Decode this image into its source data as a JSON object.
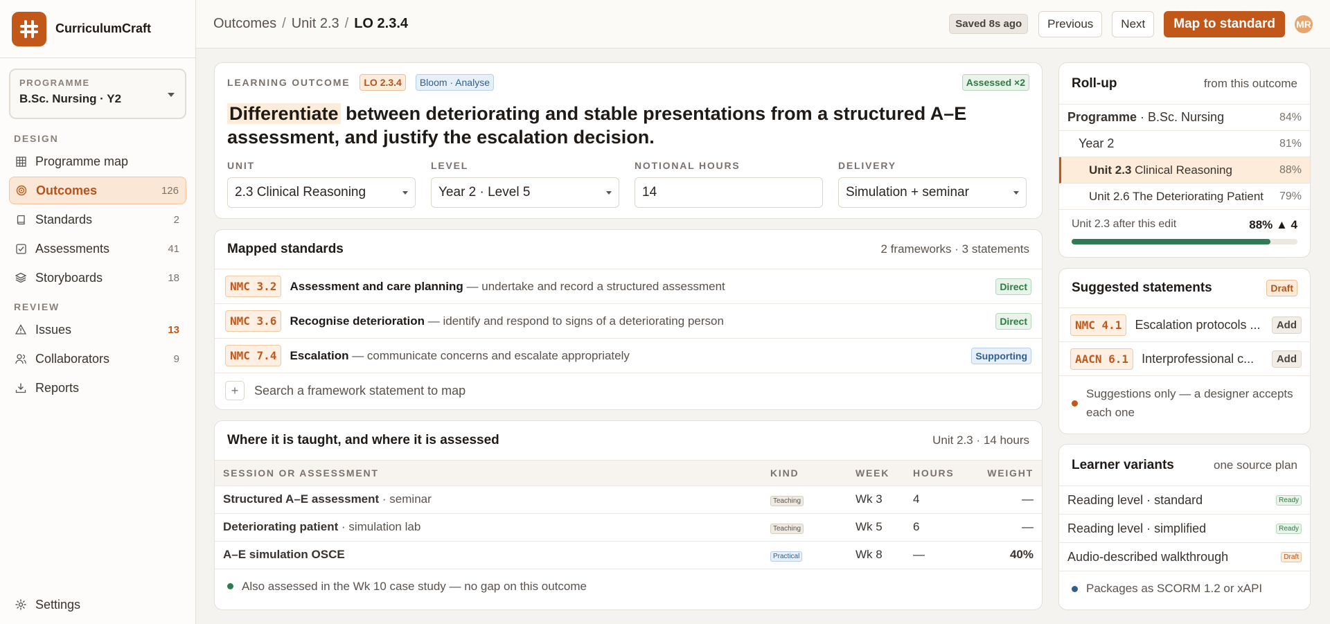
{
  "app": {
    "name": "CurriculumCraft"
  },
  "programme": {
    "label": "PROGRAMME",
    "value": "B.Sc. Nursing · Y2"
  },
  "nav": {
    "design_label": "DESIGN",
    "review_label": "REVIEW",
    "design_items": [
      {
        "label": "Programme map",
        "count": "",
        "icon": "grid-icon"
      },
      {
        "label": "Outcomes",
        "count": "126",
        "icon": "target-icon"
      },
      {
        "label": "Standards",
        "count": "2",
        "icon": "book-icon"
      },
      {
        "label": "Assessments",
        "count": "41",
        "icon": "checkbox-icon"
      },
      {
        "label": "Storyboards",
        "count": "18",
        "icon": "layers-icon"
      }
    ],
    "review_items": [
      {
        "label": "Issues",
        "count": "13",
        "icon": "warning-icon"
      },
      {
        "label": "Collaborators",
        "count": "9",
        "icon": "users-icon"
      },
      {
        "label": "Reports",
        "count": "",
        "icon": "download-icon"
      }
    ],
    "settings_label": "Settings"
  },
  "topbar": {
    "crumbs": [
      "Outcomes",
      "Unit 2.3",
      "LO 2.3.4"
    ],
    "saved": "Saved 8s ago",
    "previous": "Previous",
    "next": "Next",
    "primary": "Map to standard",
    "avatar": "MR"
  },
  "outcome": {
    "label": "LEARNING OUTCOME",
    "code": "LO 2.3.4",
    "bloom": "Bloom · Analyse",
    "assessed": "Assessed ×2",
    "verb": "Differentiate",
    "statement": " between deteriorating and stable presentations from a structured A–E assessment, and justify the escalation decision.",
    "fields": [
      {
        "label": "UNIT",
        "value": "2.3 Clinical Reasoning",
        "dropdown": true
      },
      {
        "label": "LEVEL",
        "value": "Year 2 · Level 5",
        "dropdown": true
      },
      {
        "label": "NOTIONAL HOURS",
        "value": "14",
        "dropdown": false
      },
      {
        "label": "DELIVERY",
        "value": "Simulation + seminar",
        "dropdown": true
      }
    ]
  },
  "mapped": {
    "title": "Mapped standards",
    "sub": "2 frameworks · 3 statements",
    "rows": [
      {
        "code": "NMC 3.2",
        "name": "Assessment and care planning",
        "desc": " — undertake and record a structured assessment",
        "tag": "Direct"
      },
      {
        "code": "NMC 3.6",
        "name": "Recognise deterioration",
        "desc": " — identify and respond to signs of a deteriorating person",
        "tag": "Direct"
      },
      {
        "code": "NMC 7.4",
        "name": "Escalation",
        "desc": " — communicate concerns and escalate appropriately",
        "tag": "Supporting"
      }
    ],
    "search_placeholder": "Search a framework statement to map"
  },
  "taught": {
    "title": "Where it is taught, and where it is assessed",
    "sub": "Unit 2.3 · 14 hours",
    "headers": [
      "SESSION OR ASSESSMENT",
      "KIND",
      "WEEK",
      "HOURS",
      "WEIGHT"
    ],
    "rows": [
      {
        "name": "Structured A–E assessment",
        "type": " · seminar",
        "kind": "Teaching",
        "week": "Wk 3",
        "hours": "4",
        "weight": "—"
      },
      {
        "name": "Deteriorating patient",
        "type": " · simulation lab",
        "kind": "Teaching",
        "week": "Wk 5",
        "hours": "6",
        "weight": "—"
      },
      {
        "name": "A–E simulation OSCE",
        "type": "",
        "kind": "Practical",
        "week": "Wk 8",
        "hours": "—",
        "weight": "40%"
      }
    ],
    "note": "Also assessed in the Wk 10 case study — no gap on this outcome"
  },
  "rollup": {
    "title": "Roll-up",
    "sub": "from this outcome",
    "rows": [
      {
        "bold": "Programme",
        "rest": " · B.Sc. Nursing",
        "pct": "84%"
      },
      {
        "bold": "",
        "rest": "Year 2",
        "pct": "81%"
      },
      {
        "bold": "Unit 2.3",
        "rest": " Clinical Reasoning",
        "pct": "88%"
      },
      {
        "bold": "",
        "rest": "Unit 2.6 The Deteriorating Patient",
        "pct": "79%"
      }
    ],
    "after_label": "Unit 2.3 after this edit",
    "after_value": "88% ▲ 4",
    "progress": 0.88
  },
  "suggested": {
    "title": "Suggested statements",
    "badge": "Draft",
    "rows": [
      {
        "code": "NMC 4.1",
        "text": "Escalation protocols ...",
        "action": "Add"
      },
      {
        "code": "AACN 6.1",
        "text": "Interprofessional c...",
        "action": "Add"
      }
    ],
    "note": "Suggestions only — a designer accepts each one"
  },
  "variants": {
    "title": "Learner variants",
    "sub": "one source plan",
    "rows": [
      {
        "label": "Reading level · standard",
        "status": "Ready"
      },
      {
        "label": "Reading level · simplified",
        "status": "Ready"
      },
      {
        "label": "Audio-described walkthrough",
        "status": "Draft"
      }
    ],
    "note": "Packages as SCORM 1.2 or xAPI"
  },
  "colors": {
    "accent": "#c2571a",
    "progress": "#2f7a52",
    "info": "#2f5f8f"
  }
}
